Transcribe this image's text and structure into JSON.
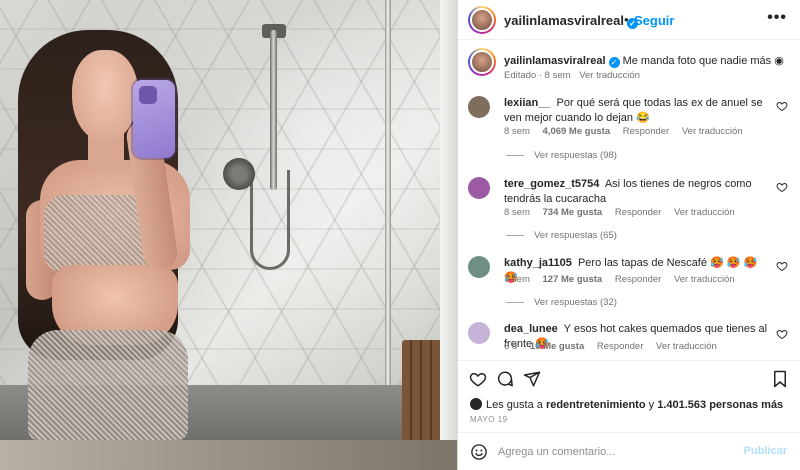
{
  "post": {
    "username": "yailinlamasviralreal",
    "follow_label": "Seguir",
    "dot": "•",
    "more_label": "•••",
    "caption": "Me manda foto que nadie más",
    "caption_emoji": "◉",
    "caption_edited": "Editado · 8 sem",
    "caption_translate": "Ver traducción"
  },
  "comments": [
    {
      "username": "lexiian__",
      "text": "Por qué será que todas las ex de anuel se ven mejor cuando lo dejan 😂",
      "time": "8 sem",
      "likes": "4,069 Me gusta",
      "reply": "Responder",
      "translate": "Ver traducción",
      "replies": "Ver respuestas (98)",
      "avatar_color": "#7f6d5e"
    },
    {
      "username": "tere_gomez_t5754",
      "text": "Asi los tienes de negros como tendrás la cucaracha",
      "time": "8 sem",
      "likes": "734 Me gusta",
      "reply": "Responder",
      "translate": "Ver traducción",
      "replies": "Ver respuestas (65)",
      "avatar_color": "#9b5aa3"
    },
    {
      "username": "kathy_ja1105",
      "text": "Pero las tapas de Nescafé 🥵 🥵 🥵 🥵",
      "time": "7 sem",
      "likes": "127 Me gusta",
      "reply": "Responder",
      "translate": "Ver traducción",
      "replies": "Ver respuestas (32)",
      "avatar_color": "#6f8f86"
    },
    {
      "username": "dea_lunee",
      "text": "Y esos hot cakes quemados que tienes al frente 🥵",
      "time": "6 d",
      "likes": "10 Me gusta",
      "reply": "Responder",
      "translate": "Ver traducción",
      "replies": "",
      "avatar_color": "#c7b2d8"
    }
  ],
  "footer": {
    "likes_prefix": "Les gusta a",
    "likes_user": "redentretenimiento",
    "likes_middle": "y",
    "likes_count": "1.401.563 personas más",
    "date": "MAYO 19",
    "comment_placeholder": "Agrega un comentario...",
    "publish_label": "Publicar"
  },
  "icons": {
    "heart": "heart-icon",
    "comment": "comment-icon",
    "share": "share-icon",
    "save": "bookmark-icon",
    "emoji": "emoji-icon",
    "verified": "verified-badge-icon"
  },
  "colors": {
    "accent": "#0095f6",
    "text": "#262626",
    "muted": "#737373",
    "publish_disabled": "#b2dffc"
  }
}
